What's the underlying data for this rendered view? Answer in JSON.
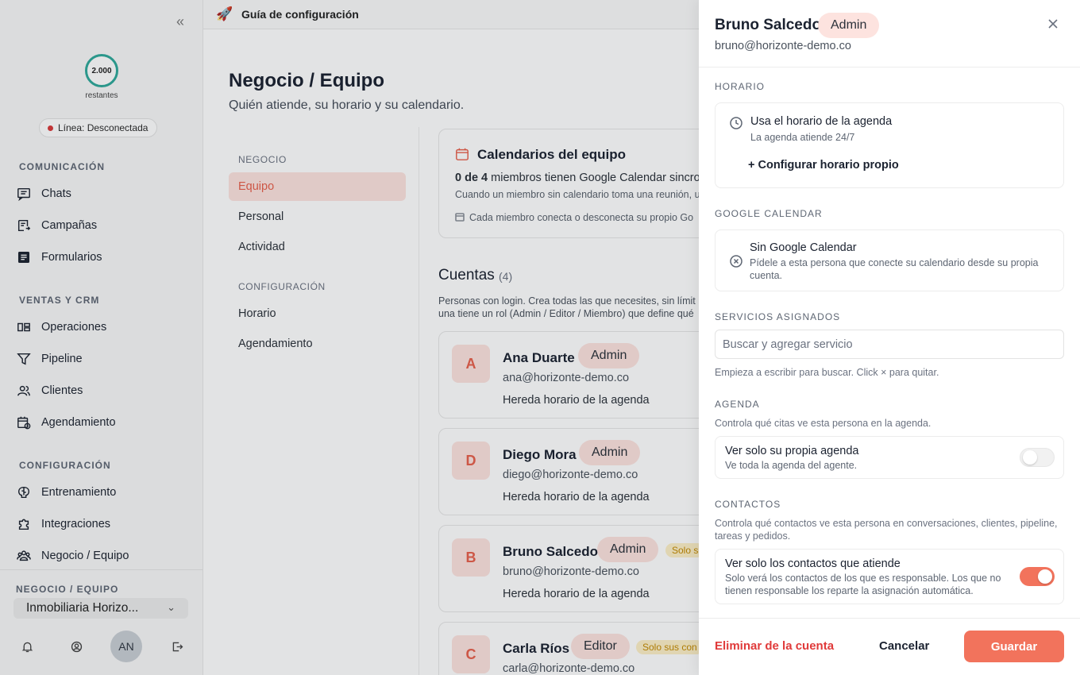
{
  "sidebar": {
    "credits_value": "2.000",
    "credits_label": "restantes",
    "status": "Línea: Desconectada",
    "status_color": "#d93a3a",
    "sections": {
      "communication": "COMUNICACIÓN",
      "sales": "VENTAS Y CRM",
      "config": "CONFIGURACIÓN"
    },
    "items": [
      {
        "label": "Chats",
        "icon": "chat-icon"
      },
      {
        "label": "Campañas",
        "icon": "campaign-icon"
      },
      {
        "label": "Formularios",
        "icon": "form-icon"
      },
      {
        "label": "Operaciones",
        "icon": "operations-icon"
      },
      {
        "label": "Pipeline",
        "icon": "filter-icon"
      },
      {
        "label": "Clientes",
        "icon": "users-icon"
      },
      {
        "label": "Agendamiento",
        "icon": "calendar-icon"
      },
      {
        "label": "Entrenamiento",
        "icon": "brain-icon"
      },
      {
        "label": "Integraciones",
        "icon": "puzzle-icon"
      },
      {
        "label": "Negocio / Equipo",
        "icon": "team-icon"
      }
    ],
    "business_section": "NEGOCIO / EQUIPO",
    "business_name": "Inmobiliaria Horizo...",
    "avatar_initials": "AN"
  },
  "topbar": {
    "title": "Guía de configuración"
  },
  "main": {
    "title": "Negocio / Equipo",
    "subtitle": "Quién atiende, su horario y su calendario.",
    "subnav": {
      "business_heading": "NEGOCIO",
      "business_items": [
        "Equipo",
        "Personal",
        "Actividad"
      ],
      "config_heading": "CONFIGURACIÓN",
      "config_items": [
        "Horario",
        "Agendamiento"
      ]
    },
    "calendar_card": {
      "title": "Calendarios del equipo",
      "count_bold": "0 de 4",
      "count_rest": " miembros tienen Google Calendar sincro",
      "line2": "Cuando un miembro sin calendario toma una reunión, u",
      "line3": "Cada miembro conecta o desconecta su propio Go"
    },
    "accounts": {
      "title": "Cuentas",
      "count": "(4)",
      "desc_line1": "Personas con login. Crea todas las que necesites, sin límit",
      "desc_line2": "una tiene un rol (Admin / Editor / Miembro) que define qué",
      "list": [
        {
          "initial": "A",
          "name": "Ana Duarte",
          "role": "Admin",
          "email": "ana@horizonte-demo.co",
          "schedule": "Hereda horario de la agenda",
          "tag": ""
        },
        {
          "initial": "D",
          "name": "Diego Mora",
          "role": "Admin",
          "email": "diego@horizonte-demo.co",
          "schedule": "Hereda horario de la agenda",
          "tag": ""
        },
        {
          "initial": "B",
          "name": "Bruno Salcedo",
          "role": "Admin",
          "email": "bruno@horizonte-demo.co",
          "schedule": "Hereda horario de la agenda",
          "tag": "Solo s"
        },
        {
          "initial": "C",
          "name": "Carla Ríos",
          "role": "Editor",
          "email": "carla@horizonte-demo.co",
          "schedule": "",
          "tag": "Solo sus con"
        }
      ]
    }
  },
  "drawer": {
    "name": "Bruno Salcedo",
    "role": "Admin",
    "email": "bruno@horizonte-demo.co",
    "schedule": {
      "heading": "HORARIO",
      "title": "Usa el horario de la agenda",
      "subtitle": "La agenda atiende 24/7",
      "link": "+ Configurar horario propio"
    },
    "google": {
      "heading": "GOOGLE CALENDAR",
      "title": "Sin Google Calendar",
      "desc_line1": "Pídele a esta persona que conecte su calendario desde su propia",
      "desc_line2": "cuenta."
    },
    "services": {
      "heading": "SERVICIOS ASIGNADOS",
      "placeholder": "Buscar y agregar servicio",
      "hint": "Empieza a escribir para buscar. Click × para quitar."
    },
    "agenda": {
      "heading": "AGENDA",
      "desc": "Controla qué citas ve esta persona en la agenda.",
      "toggle_title": "Ver solo su propia agenda",
      "toggle_sub": "Ve toda la agenda del agente.",
      "toggle_on": false
    },
    "contacts": {
      "heading": "CONTACTOS",
      "desc_line1": "Controla qué contactos ve esta persona en conversaciones, clientes, pipeline,",
      "desc_line2": "tareas y pedidos.",
      "toggle_title": "Ver solo los contactos que atiende",
      "toggle_sub_line1": "Solo verá los contactos de los que es responsable. Los que no",
      "toggle_sub_line2": "tienen responsable los reparte la asignación automática.",
      "toggle_on": true
    },
    "actions": {
      "delete": "Eliminar de la cuenta",
      "cancel": "Cancelar",
      "save": "Guardar"
    },
    "accent_color": "#f2735c"
  }
}
